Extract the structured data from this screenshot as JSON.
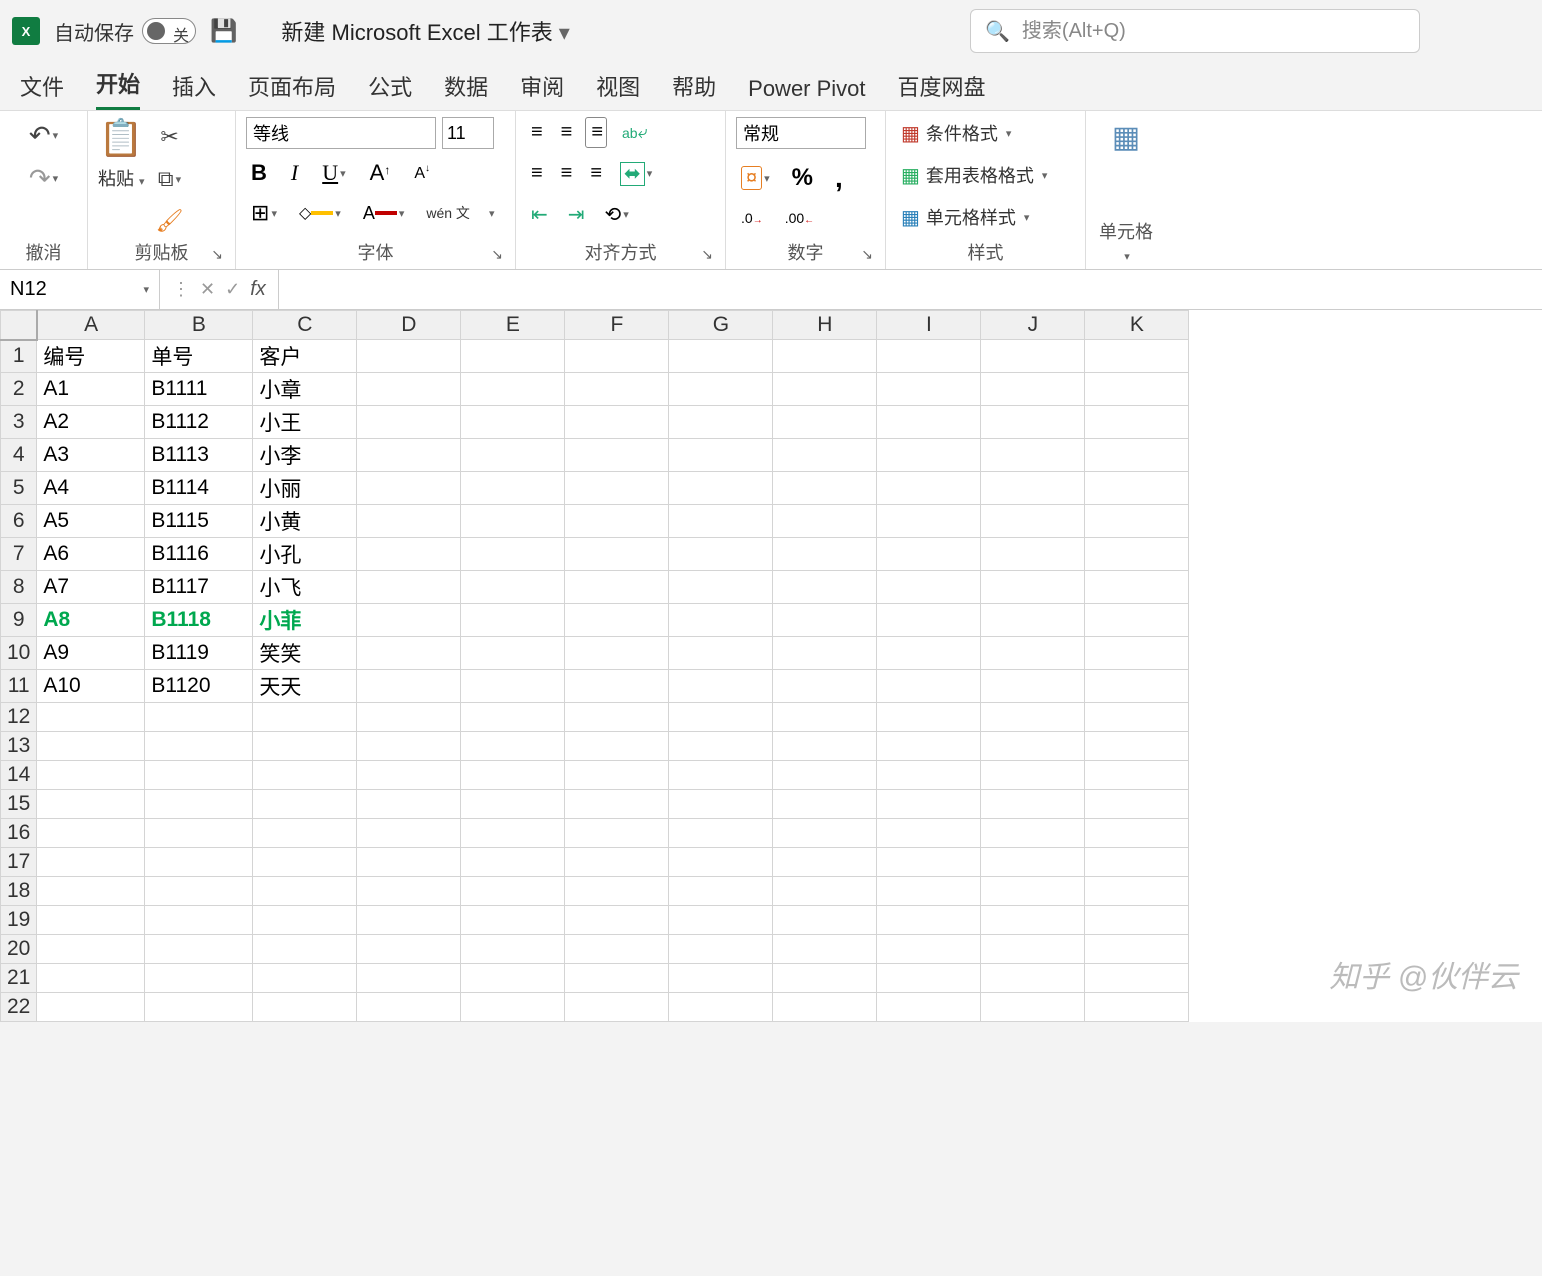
{
  "titlebar": {
    "autosave_label": "自动保存",
    "autosave_state": "关",
    "doc_title": "新建 Microsoft Excel 工作表",
    "search_placeholder": "搜索(Alt+Q)"
  },
  "tabs": [
    "文件",
    "开始",
    "插入",
    "页面布局",
    "公式",
    "数据",
    "审阅",
    "视图",
    "帮助",
    "Power Pivot",
    "百度网盘"
  ],
  "active_tab": "开始",
  "ribbon": {
    "undo_group": "撤消",
    "clipboard_group": "剪贴板",
    "paste_label": "粘贴",
    "font_group": "字体",
    "font_name": "等线",
    "font_size": "11",
    "pinyin_label": "wén\n文",
    "align_group": "对齐方式",
    "wrap_label": "ab",
    "number_group": "数字",
    "number_format": "常规",
    "styles_group": "样式",
    "cond_fmt": "条件格式",
    "table_fmt": "套用表格格式",
    "cell_style": "单元格样式",
    "cells_group": "单元格"
  },
  "formula_bar": {
    "name_box": "N12",
    "formula": ""
  },
  "columns": [
    "A",
    "B",
    "C",
    "D",
    "E",
    "F",
    "G",
    "H",
    "I",
    "J",
    "K"
  ],
  "row_count": 22,
  "headers": [
    "编号",
    "单号",
    "客户"
  ],
  "rows": [
    {
      "id": "A1",
      "order": "B1111",
      "cust": "小章",
      "hl": false
    },
    {
      "id": "A2",
      "order": "B1112",
      "cust": "小王",
      "hl": false
    },
    {
      "id": "A3",
      "order": "B1113",
      "cust": "小李",
      "hl": false
    },
    {
      "id": "A4",
      "order": "B1114",
      "cust": "小丽",
      "hl": false
    },
    {
      "id": "A5",
      "order": "B1115",
      "cust": "小黄",
      "hl": false
    },
    {
      "id": "A6",
      "order": "B1116",
      "cust": "小孔",
      "hl": false
    },
    {
      "id": "A7",
      "order": "B1117",
      "cust": "小飞",
      "hl": false
    },
    {
      "id": "A8",
      "order": "B1118",
      "cust": "小菲",
      "hl": true
    },
    {
      "id": "A9",
      "order": "B1119",
      "cust": "笑笑",
      "hl": false
    },
    {
      "id": "A10",
      "order": "B1120",
      "cust": "天天",
      "hl": false
    }
  ],
  "watermark": "知乎 @伙伴云"
}
